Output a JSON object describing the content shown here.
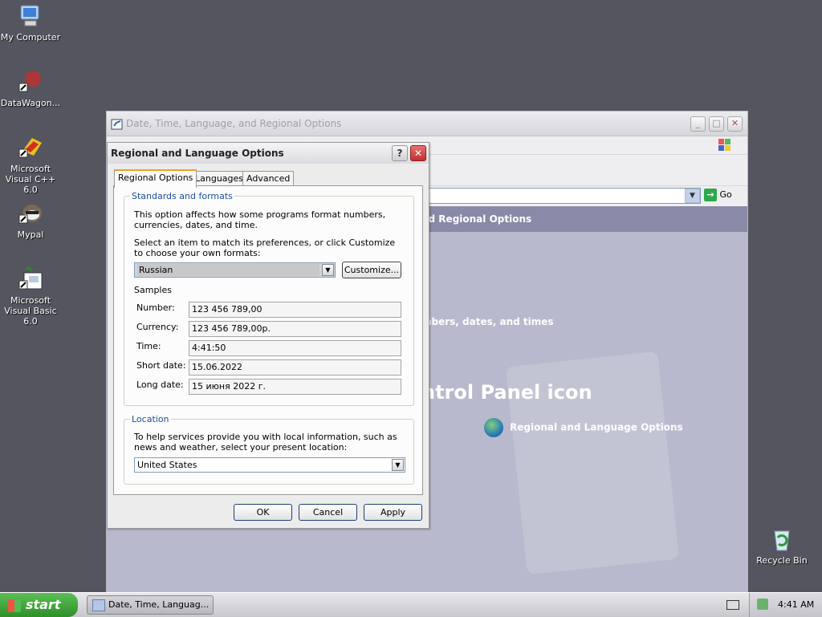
{
  "desktop": {
    "icons": [
      {
        "label": "My Computer",
        "icon": "my-computer-icon"
      },
      {
        "label": "DataWagon...",
        "icon": "datawagon-icon"
      },
      {
        "label": "Microsoft Visual C++ 6.0",
        "icon": "visual-cpp-icon"
      },
      {
        "label": "Mypal",
        "icon": "mypal-icon"
      },
      {
        "label": "Microsoft Visual Basic 6.0",
        "icon": "visual-basic-icon"
      },
      {
        "label": "Recycle Bin",
        "icon": "recycle-bin-icon"
      }
    ]
  },
  "control_panel": {
    "title": "Date, Time, Language, and Regional Options",
    "go_label": "Go",
    "header_text": "nd Regional Options",
    "subtitle": "mbers, dates, and times",
    "big_title": "ntrol Panel icon",
    "link_label": "Regional and Language Options"
  },
  "dialog": {
    "title": "Regional and Language Options",
    "help_label": "?",
    "close_label": "✕",
    "tabs": [
      "Regional Options",
      "Languages",
      "Advanced"
    ],
    "standards": {
      "legend": "Standards and formats",
      "description": "This option affects how some programs format numbers, currencies, dates, and time.",
      "instruction": "Select an item to match its preferences, or click Customize to choose your own formats:",
      "selected_format": "Russian",
      "customize_label": "Customize...",
      "samples_label": "Samples",
      "samples": [
        {
          "label": "Number:",
          "value": "123 456 789,00"
        },
        {
          "label": "Currency:",
          "value": "123 456 789,00р."
        },
        {
          "label": "Time:",
          "value": "4:41:50"
        },
        {
          "label": "Short date:",
          "value": "15.06.2022"
        },
        {
          "label": "Long date:",
          "value": "15 июня 2022 г."
        }
      ]
    },
    "location": {
      "legend": "Location",
      "description": "To help services provide you with local information, such as news and weather, select your present location:",
      "selected": "United States"
    },
    "buttons": {
      "ok": "OK",
      "cancel": "Cancel",
      "apply": "Apply"
    }
  },
  "taskbar": {
    "start_label": "start",
    "task_item": "Date, Time, Languag...",
    "clock": "4:41 AM"
  }
}
